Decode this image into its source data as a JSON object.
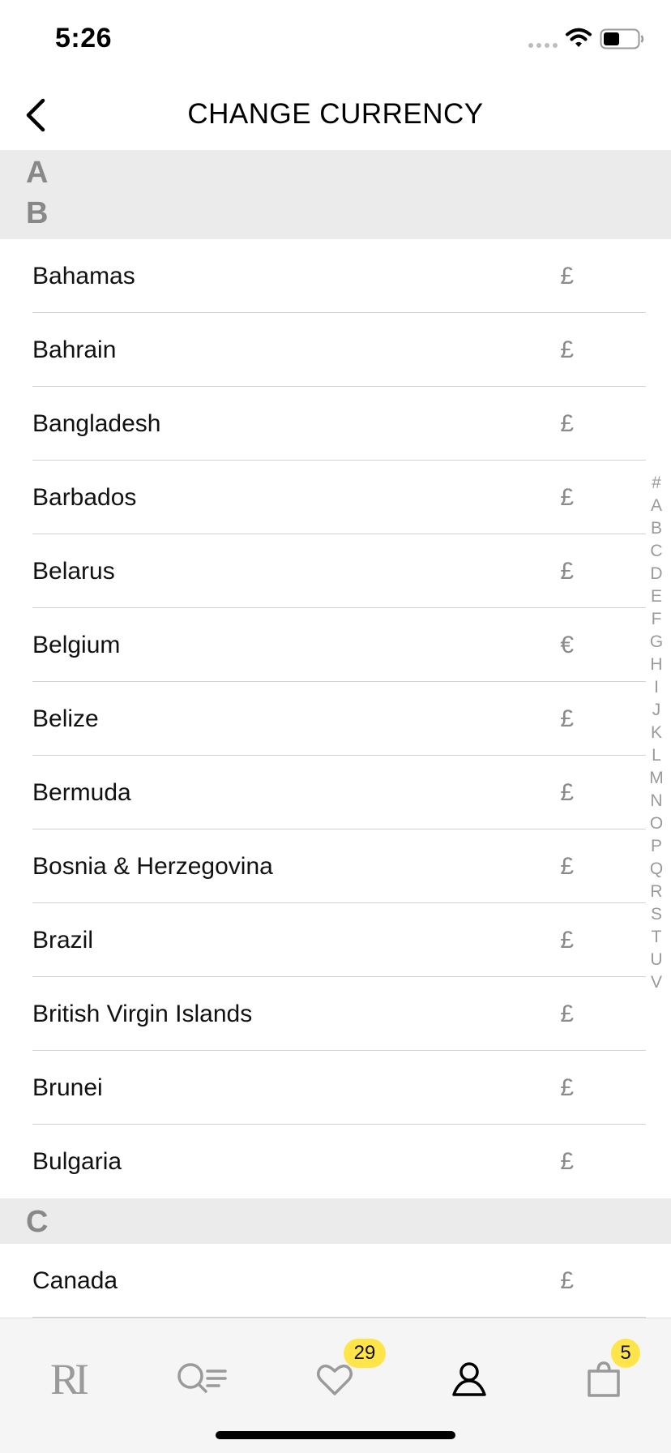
{
  "status_bar": {
    "time": "5:26"
  },
  "header": {
    "title": "CHANGE CURRENCY"
  },
  "list": {
    "sections": [
      {
        "letter": "A",
        "items": []
      },
      {
        "letter": "B",
        "items": [
          {
            "name": "Bahamas",
            "symbol": "£"
          },
          {
            "name": "Bahrain",
            "symbol": "£"
          },
          {
            "name": "Bangladesh",
            "symbol": "£"
          },
          {
            "name": "Barbados",
            "symbol": "£"
          },
          {
            "name": "Belarus",
            "symbol": "£"
          },
          {
            "name": "Belgium",
            "symbol": "€"
          },
          {
            "name": "Belize",
            "symbol": "£"
          },
          {
            "name": "Bermuda",
            "symbol": "£"
          },
          {
            "name": "Bosnia & Herzegovina",
            "symbol": "£"
          },
          {
            "name": "Brazil",
            "symbol": "£"
          },
          {
            "name": "British Virgin Islands",
            "symbol": "£"
          },
          {
            "name": "Brunei",
            "symbol": "£"
          },
          {
            "name": "Bulgaria",
            "symbol": "£"
          }
        ]
      },
      {
        "letter": "C",
        "items": [
          {
            "name": "Canada",
            "symbol": "£"
          }
        ]
      }
    ]
  },
  "index_letters": [
    "#",
    "A",
    "B",
    "C",
    "D",
    "E",
    "F",
    "G",
    "H",
    "I",
    "J",
    "K",
    "L",
    "M",
    "N",
    "O",
    "P",
    "Q",
    "R",
    "S",
    "T",
    "U",
    "V"
  ],
  "tab_bar": {
    "logo_text": "RI",
    "wishlist_count": "29",
    "bag_count": "5",
    "tabs": [
      "home-logo-icon",
      "search-filter-icon",
      "heart-icon",
      "account-icon",
      "shopping-bag-icon"
    ]
  },
  "colors": {
    "badge": "#ffe54a",
    "section_bg": "#ebebeb",
    "tab_bar_bg": "#f5f5f5",
    "muted_text": "#888888"
  }
}
